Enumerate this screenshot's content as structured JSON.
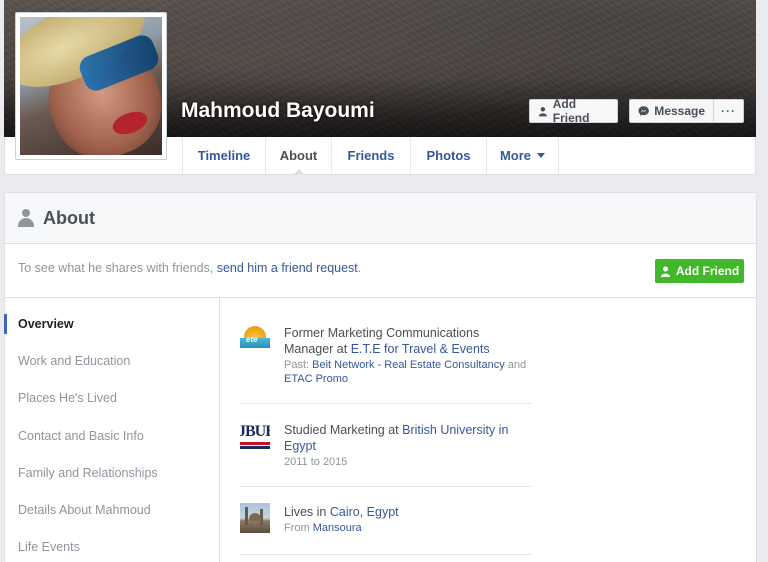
{
  "profile": {
    "name": "Mahmoud Bayoumi",
    "add_friend_label": "Add Friend",
    "message_label": "Message",
    "more_label": "···"
  },
  "nav": {
    "tabs": [
      {
        "label": "Timeline"
      },
      {
        "label": "About"
      },
      {
        "label": "Friends"
      },
      {
        "label": "Photos"
      },
      {
        "label": "More"
      }
    ],
    "active": "About"
  },
  "about": {
    "title": "About",
    "notice_prefix": "To see what he shares with friends, ",
    "notice_link": "send him a friend request",
    "notice_suffix": ".",
    "add_friend_label": "Add Friend",
    "sidebar": [
      {
        "label": "Overview"
      },
      {
        "label": "Work and Education"
      },
      {
        "label": "Places He's Lived"
      },
      {
        "label": "Contact and Basic Info"
      },
      {
        "label": "Family and Relationships"
      },
      {
        "label": "Details About Mahmoud"
      },
      {
        "label": "Life Events"
      }
    ],
    "entries": {
      "work": {
        "line1": "Former Marketing Communications",
        "line2_prefix": "Manager at ",
        "company": "E.T.E for Travel & Events",
        "past_prefix": "Past: ",
        "past_1": "Beit Network - Real Estate Consultancy",
        "past_and": " and",
        "past_2": "ETAC Promo"
      },
      "education": {
        "prefix": "Studied Marketing at ",
        "school_1": "British University in",
        "school_2": "Egypt",
        "years": "2011 to 2015"
      },
      "places": {
        "prefix": "Lives in ",
        "city": "Cairo, Egypt",
        "from_prefix": "From ",
        "from_city": "Mansoura"
      }
    }
  },
  "colors": {
    "link": "#365899",
    "green_button": "#42b72a",
    "active_marker": "#4267b2"
  }
}
